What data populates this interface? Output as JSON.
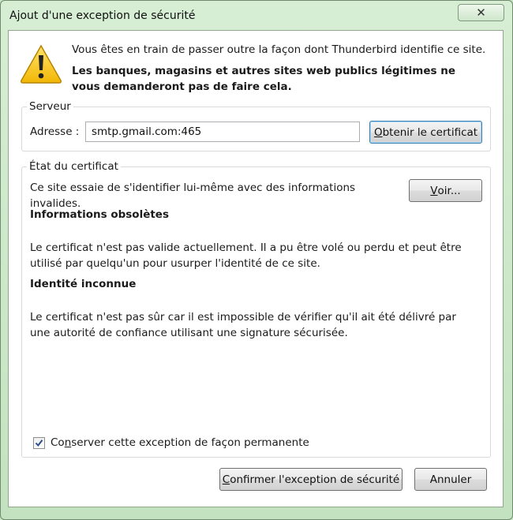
{
  "window": {
    "title": "Ajout d'une exception de sécurité",
    "close_symbol": "✕"
  },
  "intro": {
    "line1": "Vous êtes en train de passer outre la façon dont Thunderbird identifie ce site.",
    "line2": "Les banques, magasins et autres sites web publics légitimes ne vous demanderont pas de faire cela."
  },
  "server": {
    "legend": "Serveur",
    "address_label": "Adresse :",
    "address_value": "smtp.gmail.com:465",
    "get_cert_before": "",
    "get_cert_mnemonic": "O",
    "get_cert_after": "btenir le certificat"
  },
  "cert_status": {
    "legend": "État du certificat",
    "intro": "Ce site essaie de s'identifier lui-même avec des informations invalides.",
    "view_mnemonic": "V",
    "view_after": "oir...",
    "sections": [
      {
        "heading": "Informations obsolètes",
        "text": "Le certificat n'est pas valide actuellement. Il a pu être volé ou perdu et peut être utilisé par quelqu'un pour usurper l'identité de ce site."
      },
      {
        "heading": "Identité inconnue",
        "text": "Le certificat n'est pas sûr car il est impossible de vérifier qu'il ait été délivré par une autorité de confiance utilisant une signature sécurisée."
      }
    ]
  },
  "permanent": {
    "checked": true,
    "label_before": "Co",
    "label_mnemonic": "n",
    "label_after": "server cette exception de façon permanente"
  },
  "buttons": {
    "confirm_mnemonic": "C",
    "confirm_after": "onfirmer l'exception de sécurité",
    "cancel": "Annuler"
  },
  "icons": {
    "warning": "warning-triangle-icon",
    "close": "close-icon",
    "check": "checkmark-icon"
  }
}
